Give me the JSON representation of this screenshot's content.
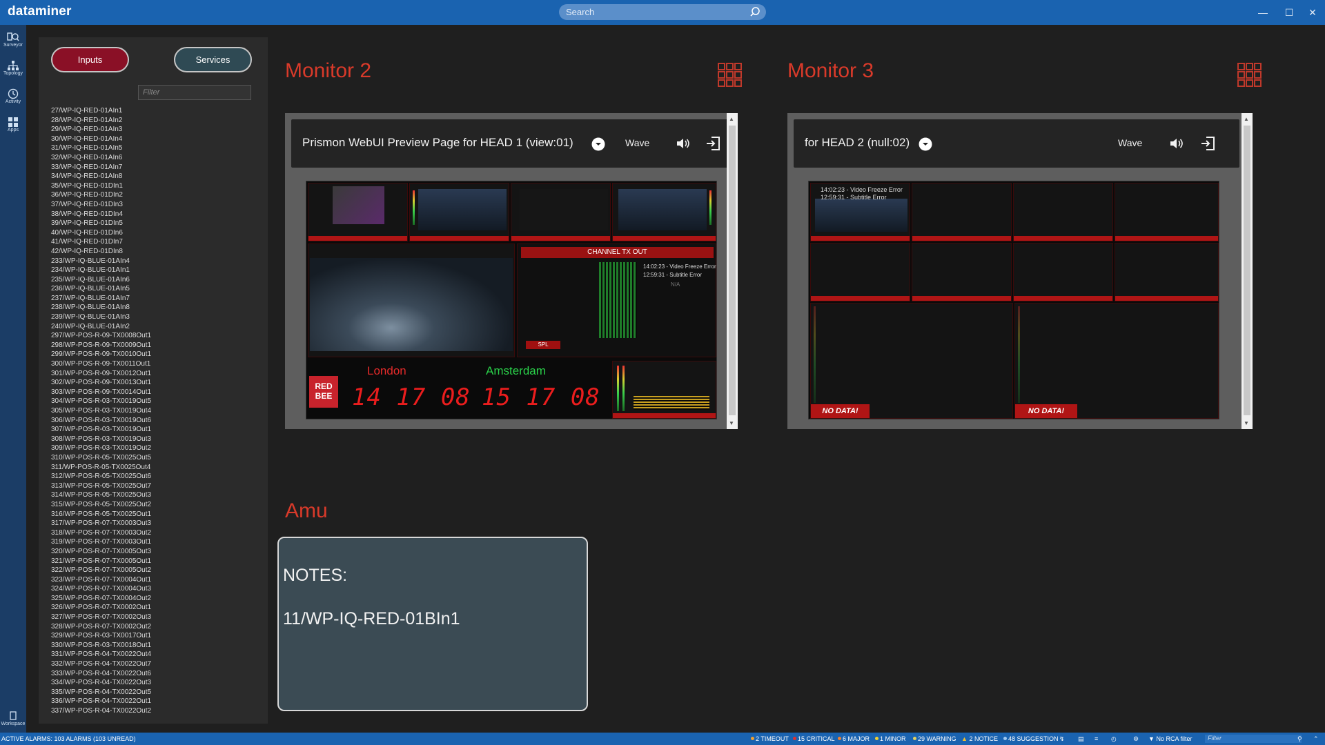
{
  "app": {
    "title": "dataminer"
  },
  "search": {
    "placeholder": "Search"
  },
  "sidebar": {
    "items": [
      {
        "label": "Surveyor",
        "icon": "surveyor-icon"
      },
      {
        "label": "Topology",
        "icon": "topology-icon"
      },
      {
        "label": "Activity",
        "icon": "activity-icon"
      },
      {
        "label": "Apps",
        "icon": "apps-icon"
      },
      {
        "label": "Workspace",
        "icon": "workspace-icon"
      }
    ]
  },
  "panel": {
    "tabs": {
      "inputs": "Inputs",
      "services": "Services"
    },
    "filter_placeholder": "Filter",
    "items": [
      "27/WP-IQ-RED-01AIn1",
      "28/WP-IQ-RED-01AIn2",
      "29/WP-IQ-RED-01AIn3",
      "30/WP-IQ-RED-01AIn4",
      "31/WP-IQ-RED-01AIn5",
      "32/WP-IQ-RED-01AIn6",
      "33/WP-IQ-RED-01AIn7",
      "34/WP-IQ-RED-01AIn8",
      "35/WP-IQ-RED-01DIn1",
      "36/WP-IQ-RED-01DIn2",
      "37/WP-IQ-RED-01DIn3",
      "38/WP-IQ-RED-01DIn4",
      "39/WP-IQ-RED-01DIn5",
      "40/WP-IQ-RED-01DIn6",
      "41/WP-IQ-RED-01DIn7",
      "42/WP-IQ-RED-01DIn8",
      "233/WP-IQ-BLUE-01AIn4",
      "234/WP-IQ-BLUE-01AIn1",
      "235/WP-IQ-BLUE-01AIn6",
      "236/WP-IQ-BLUE-01AIn5",
      "237/WP-IQ-BLUE-01AIn7",
      "238/WP-IQ-BLUE-01AIn8",
      "239/WP-IQ-BLUE-01AIn3",
      "240/WP-IQ-BLUE-01AIn2",
      "297/WP-POS-R-09-TX0008Out1",
      "298/WP-POS-R-09-TX0009Out1",
      "299/WP-POS-R-09-TX0010Out1",
      "300/WP-POS-R-09-TX0011Out1",
      "301/WP-POS-R-09-TX0012Out1",
      "302/WP-POS-R-09-TX0013Out1",
      "303/WP-POS-R-09-TX0014Out1",
      "304/WP-POS-R-03-TX0019Out5",
      "305/WP-POS-R-03-TX0019Out4",
      "306/WP-POS-R-03-TX0019Out6",
      "307/WP-POS-R-03-TX0019Out1",
      "308/WP-POS-R-03-TX0019Out3",
      "309/WP-POS-R-03-TX0019Out2",
      "310/WP-POS-R-05-TX0025Out5",
      "311/WP-POS-R-05-TX0025Out4",
      "312/WP-POS-R-05-TX0025Out6",
      "313/WP-POS-R-05-TX0025Out7",
      "314/WP-POS-R-05-TX0025Out3",
      "315/WP-POS-R-05-TX0025Out2",
      "316/WP-POS-R-05-TX0025Out1",
      "317/WP-POS-R-07-TX0003Out3",
      "318/WP-POS-R-07-TX0003Out2",
      "319/WP-POS-R-07-TX0003Out1",
      "320/WP-POS-R-07-TX0005Out3",
      "321/WP-POS-R-07-TX0005Out1",
      "322/WP-POS-R-07-TX0005Out2",
      "323/WP-POS-R-07-TX0004Out1",
      "324/WP-POS-R-07-TX0004Out3",
      "325/WP-POS-R-07-TX0004Out2",
      "326/WP-POS-R-07-TX0002Out1",
      "327/WP-POS-R-07-TX0002Out3",
      "328/WP-POS-R-07-TX0002Out2",
      "329/WP-POS-R-03-TX0017Out1",
      "330/WP-POS-R-03-TX0018Out1",
      "331/WP-POS-R-04-TX0022Out4",
      "332/WP-POS-R-04-TX0022Out7",
      "333/WP-POS-R-04-TX0022Out6",
      "334/WP-POS-R-04-TX0022Out3",
      "335/WP-POS-R-04-TX0022Out5",
      "336/WP-POS-R-04-TX0022Out1",
      "337/WP-POS-R-04-TX0022Out2"
    ]
  },
  "monitor2": {
    "title": "Monitor 2",
    "header": "Prismon WebUI Preview Page for HEAD 1 (view:01)",
    "wave_label": "Wave",
    "preview": {
      "channel_tx_out": "CHANNEL TX OUT",
      "alarm_line1": "14:02:23 - Video Freeze Error",
      "alarm_line2": "12:59:31 - Subtitle Error",
      "na": "N/A",
      "spl": "SPL",
      "city1": "London",
      "city2": "Amsterdam",
      "time1": "14 17 08",
      "time2": "15 17 08",
      "logo": "RED BEE"
    }
  },
  "monitor3": {
    "title": "Monitor 3",
    "header": "for HEAD 2 (null:02)",
    "wave_label": "Wave",
    "preview": {
      "alarm_line1": "14:02:23 - Video Freeze Error",
      "alarm_line2": "12:59:31 - Subtitle Error",
      "no_data": "NO DATA!"
    }
  },
  "amu": {
    "title": "Amu",
    "notes_label": "NOTES:",
    "notes_value": "11/WP-IQ-RED-01BIn1"
  },
  "statusbar": {
    "active_alarms": "ACTIVE ALARMS: 103 ALARMS (103 UNREAD)",
    "counts": [
      {
        "label": "2 TIMEOUT",
        "color": "#f0a030"
      },
      {
        "label": "15 CRITICAL",
        "color": "#e03030"
      },
      {
        "label": "6 MAJOR",
        "color": "#f08030"
      },
      {
        "label": "1 MINOR",
        "color": "#f0d030"
      },
      {
        "label": "29 WARNING",
        "color": "#e0d060"
      },
      {
        "label": "2 NOTICE",
        "color": "#f0c030"
      },
      {
        "label": "48 SUGGESTION",
        "color": "#9fc7ee"
      }
    ],
    "rca_filter": "No RCA filter",
    "filter_placeholder": "Filter"
  }
}
